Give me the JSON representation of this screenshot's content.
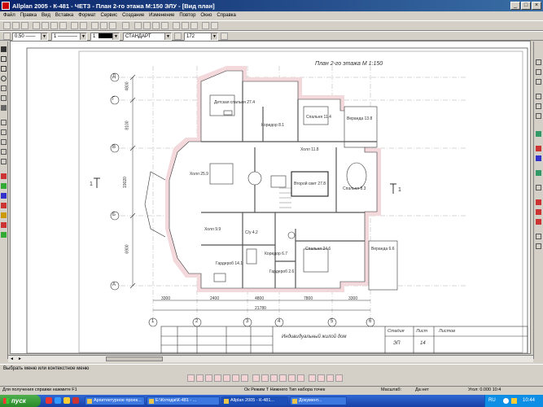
{
  "window": {
    "title": "Allplan 2005 - К-481 - ЧЕТЗ - План 2-го этажа М:150                              ЭЛУ - [Вид план]"
  },
  "menu": [
    "Файл",
    "Правка",
    "Вид",
    "Вставка",
    "Формат",
    "Сервис",
    "Создание",
    "Изменение",
    "Повтор",
    "Окно",
    "Справка"
  ],
  "format_bar": {
    "pen": "0.50",
    "line": "1",
    "color": "1",
    "layer": "СТАНДАРТ",
    "layer_num": "172"
  },
  "drawing": {
    "plan_title": "План 2-го этажа  М 1:150",
    "axes_rows": [
      "Д",
      "Г",
      "В",
      "Б",
      "А"
    ],
    "axes_cols": [
      "1",
      "2",
      "3",
      "4",
      "5",
      "6"
    ],
    "section_marks": [
      "1",
      "1"
    ],
    "dims_vertical": [
      "4800",
      "8100",
      "19020",
      "6900"
    ],
    "dims_bottom": [
      "3300",
      "2400",
      "4800",
      "7800",
      "3300"
    ],
    "dim_total": "21780",
    "rooms": [
      {
        "name": "Детская спальня",
        "area": "27.4"
      },
      {
        "name": "Спальня",
        "area": "11.4"
      },
      {
        "name": "Коридор",
        "area": "8.1"
      },
      {
        "name": "Веранда",
        "area": "13.8"
      },
      {
        "name": "Холл",
        "area": "11.8"
      },
      {
        "name": "Холл",
        "area": "25.9"
      },
      {
        "name": "Второй свет",
        "area": "27.8"
      },
      {
        "name": "Спальня",
        "area": "8.3"
      },
      {
        "name": "Холл",
        "area": "9.9"
      },
      {
        "name": "С/у",
        "area": "4.2"
      },
      {
        "name": "Коридор",
        "area": "6.7"
      },
      {
        "name": "Спальня",
        "area": "24.6"
      },
      {
        "name": "Гардероб",
        "area": "14.1"
      },
      {
        "name": "Гардероб",
        "area": "2.6"
      },
      {
        "name": "Веранда",
        "area": "6.6"
      }
    ],
    "stamp": {
      "title": "Индивидуальный жилой дом",
      "stage_label": "Стадия",
      "sheet_label": "Лист",
      "sheets_label": "Листов",
      "stage": "ЭП",
      "sheet": "14"
    }
  },
  "command_prompt": "Выбрать меню или контекстное меню",
  "status": {
    "left": "Для получения справки нажмите F1",
    "middle": "Ок    Режим    Т Нижнего    Тип набора точек",
    "scale": "Масштаб:",
    "zoom": "Да нет",
    "right": "Угол: 0.000    10:4"
  },
  "taskbar": {
    "start": "пуск",
    "tasks": [
      "Архитектурное проек...",
      "E:\\Котедж\\К-481 - ...",
      "Allplan 2005 - К-481...",
      "Документ..."
    ],
    "lang": "RU",
    "clock": "10:44"
  }
}
